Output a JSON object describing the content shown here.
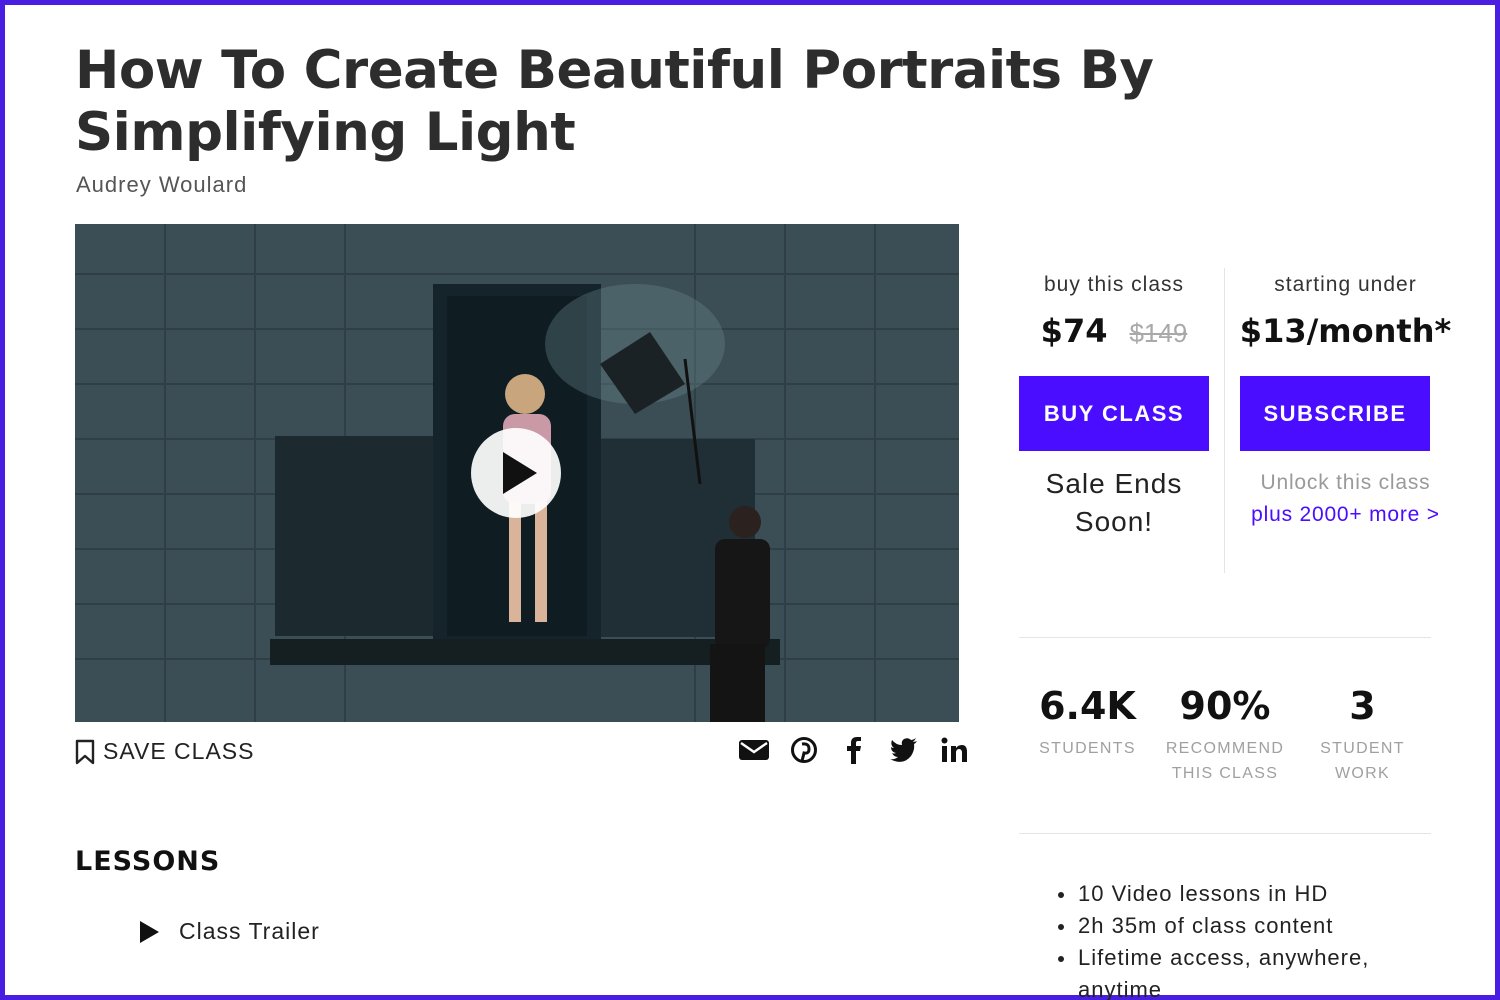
{
  "course": {
    "title": "How To Create Beautiful Portraits By Simplifying Light",
    "author": "Audrey Woulard"
  },
  "video": {
    "play_icon": "play-icon"
  },
  "actions": {
    "save_label": "SAVE CLASS",
    "save_icon": "bookmark-icon",
    "share_icons": [
      "email-icon",
      "pinterest-icon",
      "facebook-icon",
      "twitter-icon",
      "linkedin-icon"
    ]
  },
  "lessons": {
    "heading": "LESSONS",
    "items": [
      {
        "label": "Class Trailer"
      }
    ]
  },
  "buy": {
    "label": "buy this class",
    "price": "$74",
    "old_price": "$149",
    "button": "BUY CLASS",
    "note": "Sale Ends Soon!"
  },
  "subscribe": {
    "label": "starting under",
    "price": "$13/month*",
    "button": "SUBSCRIBE",
    "unlock_text": "Unlock this class",
    "more_link": "plus 2000+ more >"
  },
  "stats": [
    {
      "value": "6.4K",
      "label": "STUDENTS"
    },
    {
      "value": "90%",
      "label": "RECOMMEND THIS CLASS"
    },
    {
      "value": "3",
      "label": "STUDENT WORK"
    }
  ],
  "features": [
    "10 Video lessons in HD",
    "2h 35m of class content",
    "Lifetime access, anywhere, anytime"
  ],
  "colors": {
    "accent": "#4a0dff",
    "frame": "#4a1ee0"
  }
}
